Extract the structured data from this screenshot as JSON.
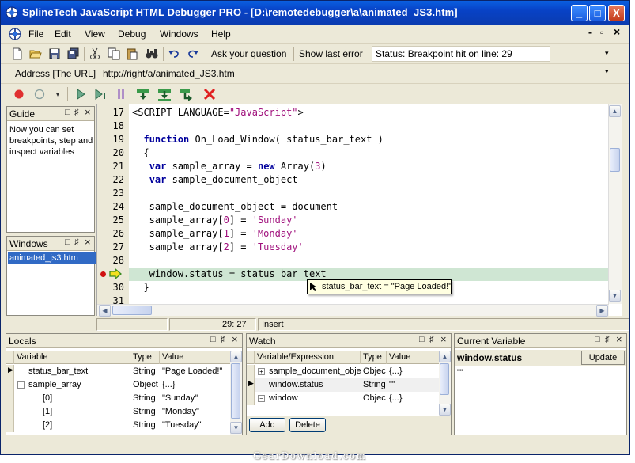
{
  "window": {
    "title": "SplineTech JavaScript HTML Debugger PRO - [D:\\remotedebugger\\a\\animated_JS3.htm]",
    "minimize": "_",
    "maximize": "□",
    "close": "X"
  },
  "menu": {
    "items": [
      "File",
      "Edit",
      "View",
      "Debug",
      "Windows",
      "Help"
    ],
    "doc_minimize": "-",
    "doc_restore": "▫",
    "doc_close": "×"
  },
  "toolbar": {
    "ask_question": "Ask your question",
    "show_last_error": "Show last error",
    "status": "Status: Breakpoint hit on line: 29"
  },
  "address": {
    "label": "Address [The URL]",
    "value": "http://right/a/animated_JS3.htm"
  },
  "guide": {
    "title": "Guide",
    "text": "Now you can set breakpoints, step and inspect variables"
  },
  "windows_panel": {
    "title": "Windows",
    "items": [
      "animated_js3.htm"
    ]
  },
  "panel_controls": {
    "menu": "□",
    "pin": "♯",
    "close": "×"
  },
  "editor": {
    "line_numbers": [
      "17",
      "18",
      "19",
      "20",
      "21",
      "22",
      "23",
      "24",
      "25",
      "26",
      "27",
      "28",
      "29",
      "30",
      "31"
    ],
    "current_line": "29",
    "tooltip": "status_bar_text = \"Page Loaded!\""
  },
  "statusbar": {
    "position": "29: 27",
    "mode": "Insert"
  },
  "locals": {
    "title": "Locals",
    "columns": [
      "Variable",
      "Type",
      "Value"
    ],
    "rows": [
      {
        "name": "status_bar_text",
        "type": "String",
        "value": "\"Page Loaded!\""
      },
      {
        "name": "sample_array",
        "type": "Object",
        "value": "{...}"
      },
      {
        "name": "[0]",
        "type": "String",
        "value": "\"Sunday\""
      },
      {
        "name": "[1]",
        "type": "String",
        "value": "\"Monday\""
      },
      {
        "name": "[2]",
        "type": "String",
        "value": "\"Tuesday\""
      }
    ]
  },
  "watch": {
    "title": "Watch",
    "columns": [
      "Variable/Expression",
      "Type",
      "Value"
    ],
    "rows": [
      {
        "name": "sample_document_obje",
        "type": "Objec",
        "value": "{...}"
      },
      {
        "name": "window.status",
        "type": "String",
        "value": "\"\""
      },
      {
        "name": "window",
        "type": "Objec",
        "value": "{...}"
      }
    ],
    "add": "Add",
    "delete": "Delete"
  },
  "current_variable": {
    "title": "Current Variable",
    "name": "window.status",
    "update": "Update",
    "value": "\"\""
  },
  "watermark": "GearDownload.com",
  "colors": {
    "titlebar": "#0842c6",
    "selection": "#316ac5",
    "current_line": "#cfe6d3",
    "keyword": "#00009c",
    "string": "#a0107c",
    "breakpoint": "#d01010"
  }
}
